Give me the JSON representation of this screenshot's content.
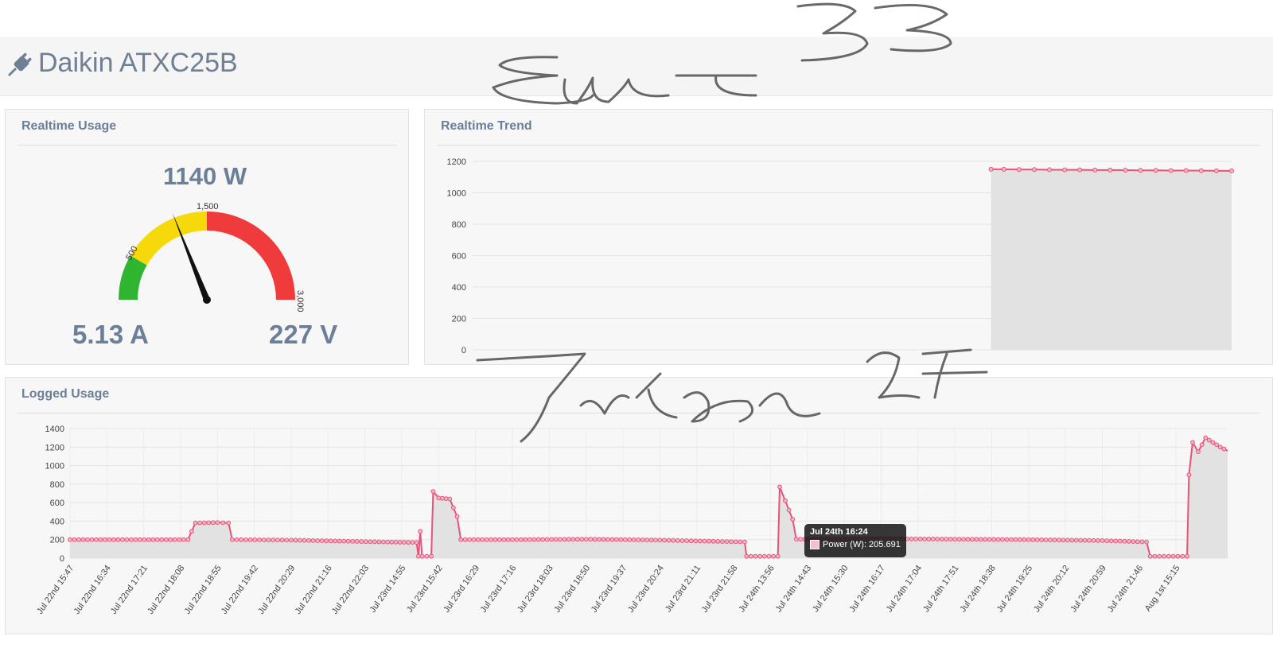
{
  "header": {
    "title": "Daikin ATXC25B",
    "icon": "plug-icon"
  },
  "realtime_usage": {
    "title": "Realtime Usage",
    "power": "1140 W",
    "current": "5.13 A",
    "voltage": "227 V",
    "gauge": {
      "min": 0,
      "max": 3000,
      "value": 1140,
      "labels": [
        "500",
        "1,500",
        "3,000"
      ],
      "colors": {
        "green": "#2fb52f",
        "yellow": "#f5d90a",
        "red": "#ef3b3b"
      }
    }
  },
  "realtime_trend": {
    "title": "Realtime Trend"
  },
  "logged_usage": {
    "title": "Logged Usage",
    "tooltip": {
      "title": "Jul 24th 16:24",
      "label": "Power (W): 205.691"
    }
  },
  "chart_data": [
    {
      "type": "area",
      "title": "",
      "ylim": [
        0,
        1200
      ],
      "yticks": [
        0,
        200,
        400,
        600,
        800,
        1000,
        1200
      ],
      "series": [
        {
          "x_fraction": [
            0.683,
            0.7,
            0.72,
            0.74,
            0.76,
            0.78,
            0.8,
            0.82,
            0.84,
            0.86,
            0.88,
            0.9,
            0.92,
            0.94,
            0.96,
            0.98,
            1.0
          ],
          "values": [
            1150,
            1150,
            1148,
            1148,
            1147,
            1146,
            1146,
            1145,
            1145,
            1144,
            1143,
            1143,
            1142,
            1142,
            1141,
            1140,
            1140
          ]
        }
      ],
      "color": "#e8537a"
    },
    {
      "type": "area",
      "title": "",
      "ylim": [
        0,
        1400
      ],
      "yticks": [
        0,
        200,
        400,
        600,
        800,
        1000,
        1200,
        1400
      ],
      "categories": [
        "Jul 22nd 15:47",
        "Jul 22nd 16:34",
        "Jul 22nd 17:21",
        "Jul 22nd 18:08",
        "Jul 22nd 18:55",
        "Jul 22nd 19:42",
        "Jul 22nd 20:29",
        "Jul 22nd 21:16",
        "Jul 22nd 22:03",
        "Jul 23rd 14:55",
        "Jul 23rd 15:42",
        "Jul 23rd 16:29",
        "Jul 23rd 17:16",
        "Jul 23rd 18:03",
        "Jul 23rd 18:50",
        "Jul 23rd 19:37",
        "Jul 23rd 20:24",
        "Jul 23rd 21:11",
        "Jul 23rd 21:58",
        "Jul 24th 13:56",
        "Jul 24th 14:43",
        "Jul 24th 15:30",
        "Jul 24th 16:17",
        "Jul 24th 17:04",
        "Jul 24th 17:51",
        "Jul 24th 18:38",
        "Jul 24th 19:25",
        "Jul 24th 20:12",
        "Jul 24th 20:59",
        "Jul 24th 21:46",
        "Aug 1st 15:15"
      ],
      "series": [
        {
          "name": "Power (W)",
          "points": [
            [
              0,
              200
            ],
            [
              3.2,
              200
            ],
            [
              3.4,
              380
            ],
            [
              4.0,
              385
            ],
            [
              4.3,
              380
            ],
            [
              4.4,
              200
            ],
            [
              6,
              195
            ],
            [
              8.5,
              175
            ],
            [
              9.4,
              170
            ],
            [
              9.45,
              20
            ],
            [
              9.5,
              290
            ],
            [
              9.55,
              20
            ],
            [
              9.8,
              20
            ],
            [
              9.85,
              720
            ],
            [
              10.0,
              650
            ],
            [
              10.3,
              640
            ],
            [
              10.5,
              450
            ],
            [
              10.6,
              200
            ],
            [
              12,
              200
            ],
            [
              14,
              205
            ],
            [
              16,
              195
            ],
            [
              18.3,
              175
            ],
            [
              18.35,
              20
            ],
            [
              19.2,
              20
            ],
            [
              19.25,
              770
            ],
            [
              19.4,
              620
            ],
            [
              19.6,
              420
            ],
            [
              19.7,
              205
            ],
            [
              20.5,
              205
            ],
            [
              22,
              210
            ],
            [
              24,
              205
            ],
            [
              26,
              200
            ],
            [
              28,
              190
            ],
            [
              29.2,
              175
            ],
            [
              29.3,
              20
            ],
            [
              30.3,
              20
            ],
            [
              30.35,
              900
            ],
            [
              30.45,
              1250
            ],
            [
              30.6,
              1150
            ],
            [
              30.8,
              1300
            ],
            [
              31.0,
              1250
            ],
            [
              31.2,
              1200
            ],
            [
              31.4,
              1160
            ]
          ]
        }
      ],
      "color": "#e8537a"
    }
  ]
}
